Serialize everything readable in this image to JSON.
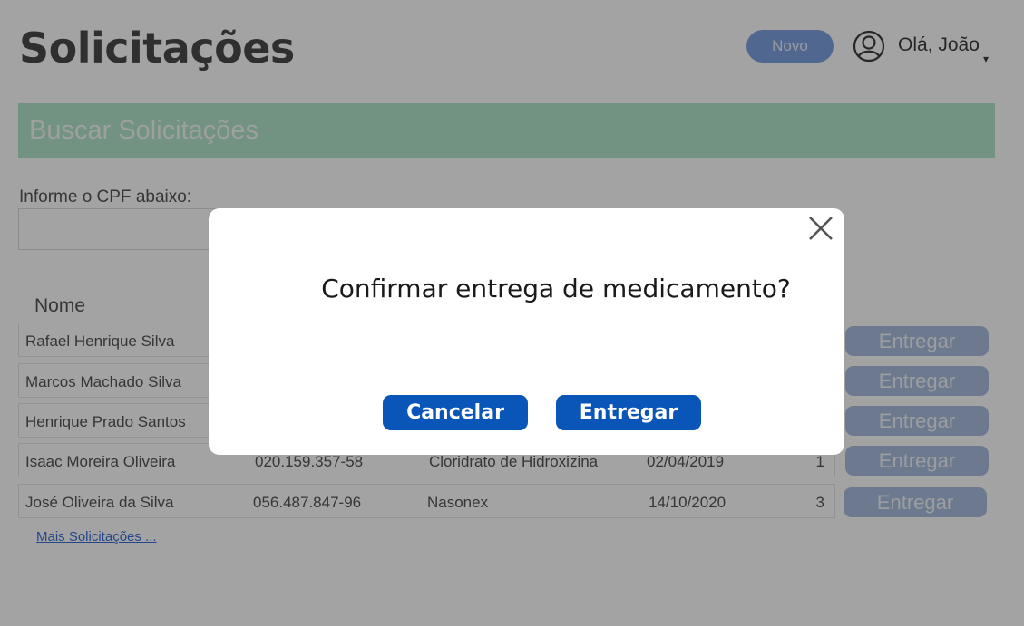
{
  "header": {
    "title": "Solicitações",
    "new_button_label": "Novo",
    "user_greeting": "Olá, João",
    "dropdown_caret": "▾"
  },
  "search": {
    "banner_title": "Buscar Solicitações",
    "cpf_label": "Informe o CPF abaixo:",
    "cpf_value": "",
    "cpf_placeholder": ""
  },
  "table": {
    "visible_header": "Nome",
    "rows": [
      {
        "nome": "Rafael Henrique Silva",
        "cpf": "",
        "medicamento": "",
        "data": "",
        "quantidade": "",
        "action_label": "Entregar"
      },
      {
        "nome": "Marcos Machado Silva",
        "cpf": "",
        "medicamento": "",
        "data": "",
        "quantidade": "",
        "action_label": "Entregar"
      },
      {
        "nome": "Henrique Prado Santos",
        "cpf": "",
        "medicamento": "",
        "data": "",
        "quantidade": "",
        "action_label": "Entregar"
      },
      {
        "nome": "Isaac Moreira Oliveira",
        "cpf": "020.159.357-58",
        "medicamento": "Cloridrato de Hidroxizina",
        "data": "02/04/2019",
        "quantidade": "1",
        "action_label": "Entregar"
      },
      {
        "nome": "José Oliveira da Silva",
        "cpf": "056.487.847-96",
        "medicamento": "Nasonex",
        "data": "14/10/2020",
        "quantidade": "3",
        "action_label": "Entregar"
      }
    ],
    "more_link": "Mais Solicitações ..."
  },
  "modal": {
    "message": "Confirmar entrega de medicamento?",
    "cancel_label": "Cancelar",
    "confirm_label": "Entregar",
    "close_icon": "close-icon"
  },
  "colors": {
    "title": "#4a4a4a",
    "new_button": "#7ea2e0",
    "banner": "#b2e4cb",
    "row_button": "#a9bddf",
    "link": "#3a6fd8",
    "overlay": "rgba(0,0,0,0.36)",
    "modal_button": "#0a55b8"
  }
}
